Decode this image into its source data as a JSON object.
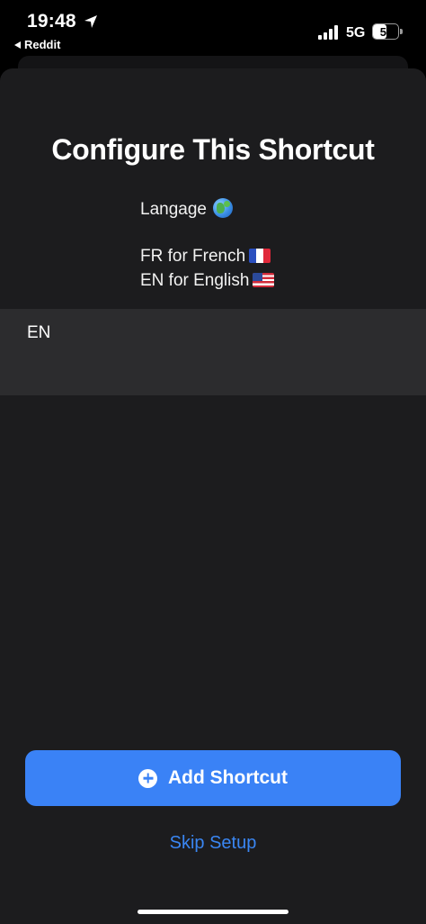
{
  "status_bar": {
    "time": "19:48",
    "back_app": "Reddit",
    "network": "5G",
    "battery_level": "53",
    "battery_percent": 53
  },
  "sheet": {
    "title": "Configure This Shortcut",
    "description": {
      "line1": "Langage",
      "line2": "FR for French",
      "line3": "EN for English"
    },
    "input_value": "EN",
    "add_button_label": "Add Shortcut",
    "skip_label": "Skip Setup"
  },
  "colors": {
    "accent": "#3a82f6",
    "sheet_background": "#1c1c1e",
    "input_background": "#2c2c2e"
  }
}
